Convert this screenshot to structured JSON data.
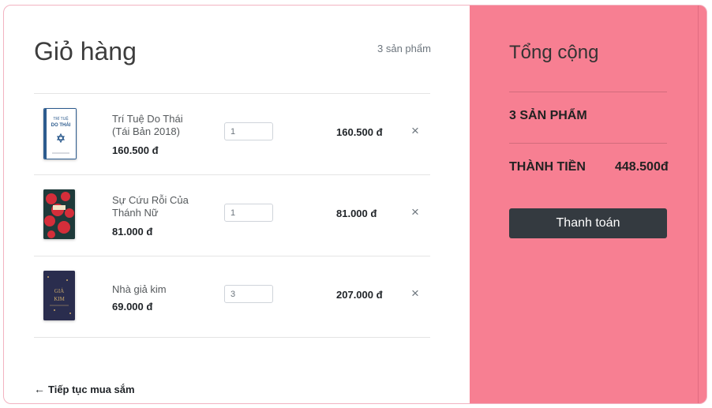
{
  "cart": {
    "title": "Giỏ hàng",
    "count_text": "3 sản phẩm",
    "continue_icon": "arrow-left-icon",
    "continue_label": "Tiếp tục mua sắm",
    "items": [
      {
        "name": "Trí Tuệ Do Thái (Tái Bản 2018)",
        "unit_price": "160.500 đ",
        "quantity": "1",
        "total": "160.500 đ",
        "remove_icon": "close-icon"
      },
      {
        "name": "Sự Cứu Rỗi Của Thánh Nữ",
        "unit_price": "81.000 đ",
        "quantity": "1",
        "total": "81.000 đ",
        "remove_icon": "close-icon"
      },
      {
        "name": "Nhà giả kim",
        "unit_price": "69.000 đ",
        "quantity": "3",
        "total": "207.000 đ",
        "remove_icon": "close-icon"
      }
    ],
    "remove_symbol": "×",
    "covers": {
      "book1": {
        "title_text": "TRÍ TUỆ DO THÁI",
        "colors": [
          "#ffffff",
          "#2c5b8e"
        ]
      },
      "book2": {
        "title_text": "",
        "colors": [
          "#1e3a3a",
          "#d42e3a"
        ]
      },
      "book3": {
        "title_text": "GIẢ KIM",
        "colors": [
          "#2a2d4e",
          "#c9a86a"
        ]
      }
    }
  },
  "summary": {
    "title": "Tổng cộng",
    "items_text": "3 SẢN PHẨM",
    "total_label": "THÀNH TIỀN",
    "total_value": "448.500đ",
    "checkout_label": "Thanh toán",
    "bg_color": "#f77f92",
    "button_color": "#343a40"
  }
}
